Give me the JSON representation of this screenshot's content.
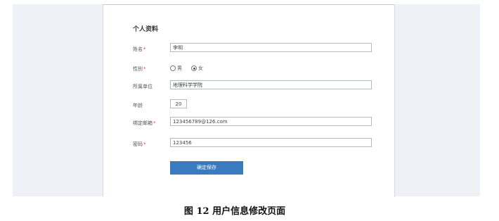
{
  "form": {
    "title": "个人资料",
    "name": {
      "label": "姓名",
      "value": "李明"
    },
    "gender": {
      "label": "性别",
      "options": [
        "男",
        "女"
      ],
      "selected": "女"
    },
    "unit": {
      "label": "所属单位",
      "value": "地理科学学院"
    },
    "age": {
      "label": "年龄",
      "value": "20"
    },
    "email": {
      "label": "绑定邮箱",
      "value": "123456789@126.com"
    },
    "password": {
      "label": "密码",
      "value": "123456"
    },
    "required_mark": "*",
    "save_label": "确定保存"
  },
  "caption": "图 12 用户信息修改页面",
  "colors": {
    "button": "#3a7bbf",
    "required": "#e04040",
    "background": "#eef1f6"
  }
}
